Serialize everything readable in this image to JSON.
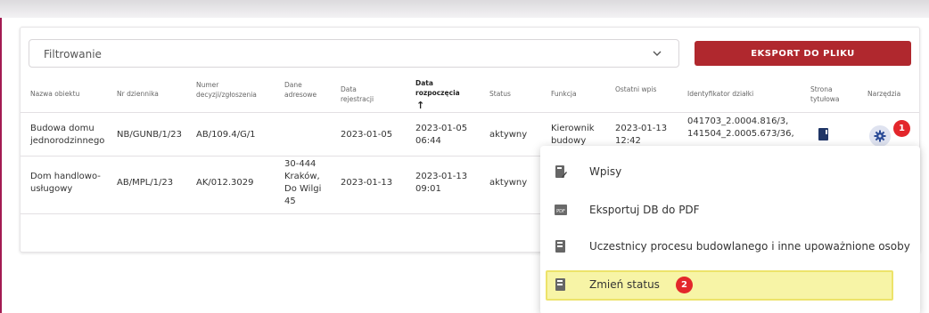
{
  "filter": {
    "label": "Filtrowanie"
  },
  "export_button": "EKSPORT DO PLIKU",
  "table": {
    "headers": [
      "Nazwa obiektu",
      "Nr dziennika",
      "Numer decyzji/zgłoszenia",
      "Dane adresowe",
      "Data rejestracji",
      "Data rozpoczęcia",
      "Status",
      "Funkcja",
      "Ostatni wpis",
      "Identyfikator działki",
      "Strona tytułowa",
      "Narzędzia"
    ],
    "sort_arrow": "↑",
    "rows": [
      {
        "name": "Budowa domu jednorodzinnego",
        "journal": "NB/GUNB/1/23",
        "decision": "AB/109.4/G/1",
        "address": "",
        "registered": "2023-01-05",
        "start": "2023-01-05 06:44",
        "status": "aktywny",
        "function": "Kierownik budowy",
        "last_entry": "2023-01-13 12:42",
        "parcel": "041703_2.0004.816/3, 141504_2.0005.673/36,"
      },
      {
        "name": "Dom handlowo-usługowy",
        "journal": "AB/MPL/1/23",
        "decision": "AK/012.3029",
        "address": "30-444 Kraków, Do Wilgi 45",
        "registered": "2023-01-13",
        "start": "2023-01-13 09:01",
        "status": "aktywny",
        "function": "",
        "last_entry": "",
        "parcel": ""
      }
    ]
  },
  "badges": {
    "first": "1",
    "second": "2"
  },
  "menu": {
    "items": [
      {
        "label": "Wpisy",
        "icon": "book-edit-icon"
      },
      {
        "label": "Eksportuj DB do PDF",
        "icon": "pdf-icon"
      },
      {
        "label": "Uczestnicy procesu budowlanego i inne upoważnione osoby",
        "icon": "book-people-icon"
      },
      {
        "label": "Zmień status",
        "icon": "book-status-icon"
      }
    ]
  },
  "colors": {
    "accent": "#b0282e",
    "badge": "#e3262b",
    "frame_border": "#a31b52",
    "highlight": "#f7f4a6",
    "gear_bg": "#dfe3f0"
  }
}
